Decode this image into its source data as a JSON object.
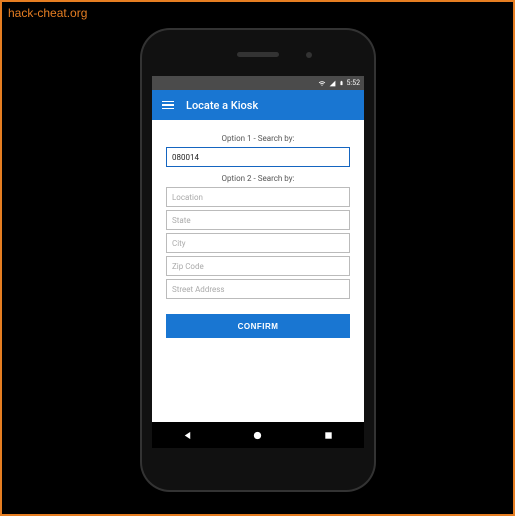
{
  "watermark": "hack-cheat.org",
  "status": {
    "time": "5:52"
  },
  "appbar": {
    "title": "Locate a Kiosk"
  },
  "option1": {
    "label": "Option 1 - Search by:",
    "field": {
      "value": "080014"
    }
  },
  "option2": {
    "label": "Option 2 - Search by:",
    "fields": {
      "location": {
        "placeholder": "Location"
      },
      "state": {
        "placeholder": "State"
      },
      "city": {
        "placeholder": "City"
      },
      "zip": {
        "placeholder": "Zip Code"
      },
      "street": {
        "placeholder": "Street Address"
      }
    }
  },
  "confirm": {
    "label": "CONFIRM"
  }
}
